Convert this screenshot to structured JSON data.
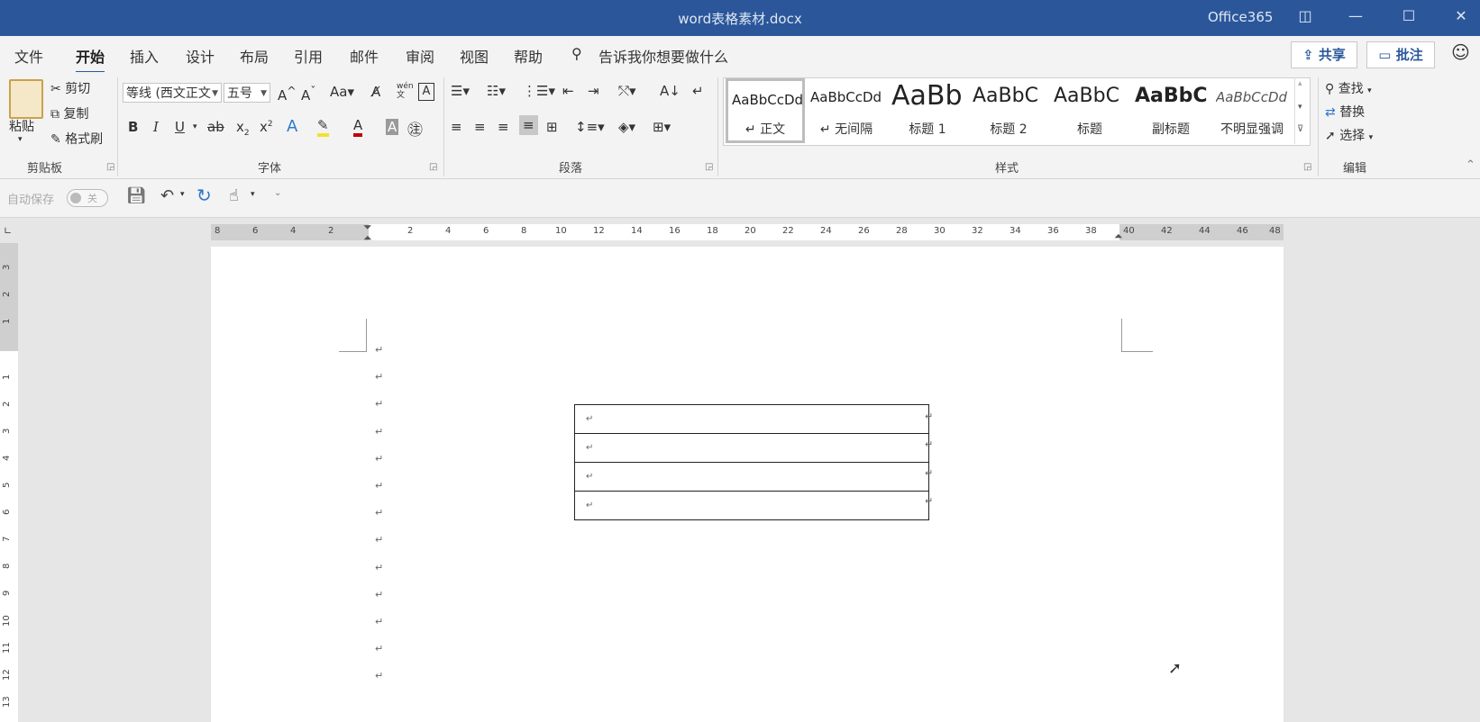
{
  "window": {
    "title": "word表格素材.docx",
    "account": "Office365",
    "controls": [
      "◫",
      "—",
      "☐",
      "✕"
    ]
  },
  "menu": {
    "tabs": [
      "文件",
      "开始",
      "插入",
      "设计",
      "布局",
      "引用",
      "邮件",
      "审阅",
      "视图",
      "帮助"
    ],
    "tell_me": "告诉我你想要做什么",
    "share": "共享",
    "comment": "批注"
  },
  "clipboard": {
    "paste": "粘贴",
    "cut": "剪切",
    "copy": "复制",
    "format_painter": "格式刷",
    "label": "剪贴板"
  },
  "font": {
    "name": "等线 (西文正文",
    "size": "五号",
    "label": "字体",
    "wen": "wén\n文"
  },
  "paragraph": {
    "label": "段落"
  },
  "styles": {
    "label": "样式",
    "items": [
      {
        "sample": "AaBbCcDd",
        "name": "↵ 正文"
      },
      {
        "sample": "AaBbCcDd",
        "name": "↵ 无间隔"
      },
      {
        "sample": "AaBb",
        "name": "标题 1"
      },
      {
        "sample": "AaBbC",
        "name": "标题 2"
      },
      {
        "sample": "AaBbC",
        "name": "标题"
      },
      {
        "sample": "AaBbC",
        "name": "副标题"
      },
      {
        "sample": "AaBbCcDd",
        "name": "不明显强调"
      }
    ]
  },
  "editing": {
    "find": "查找",
    "replace": "替换",
    "select": "选择",
    "label": "编辑"
  },
  "qat": {
    "autosave": "自动保存",
    "autosave_state": "关"
  },
  "ruler": {
    "h_labels": [
      "8",
      "6",
      "4",
      "2",
      "2",
      "4",
      "6",
      "8",
      "10",
      "12",
      "14",
      "16",
      "18",
      "20",
      "22",
      "24",
      "26",
      "28",
      "30",
      "32",
      "34",
      "36",
      "38",
      "40",
      "42",
      "44",
      "46",
      "48"
    ],
    "v_labels_top": [
      "3",
      "2",
      "1"
    ],
    "v_labels": [
      "1",
      "2",
      "3",
      "4",
      "5",
      "6",
      "7",
      "8",
      "9",
      "10",
      "11",
      "12",
      "13"
    ]
  },
  "document": {
    "para_mark": "↵",
    "table_rows": 4
  }
}
